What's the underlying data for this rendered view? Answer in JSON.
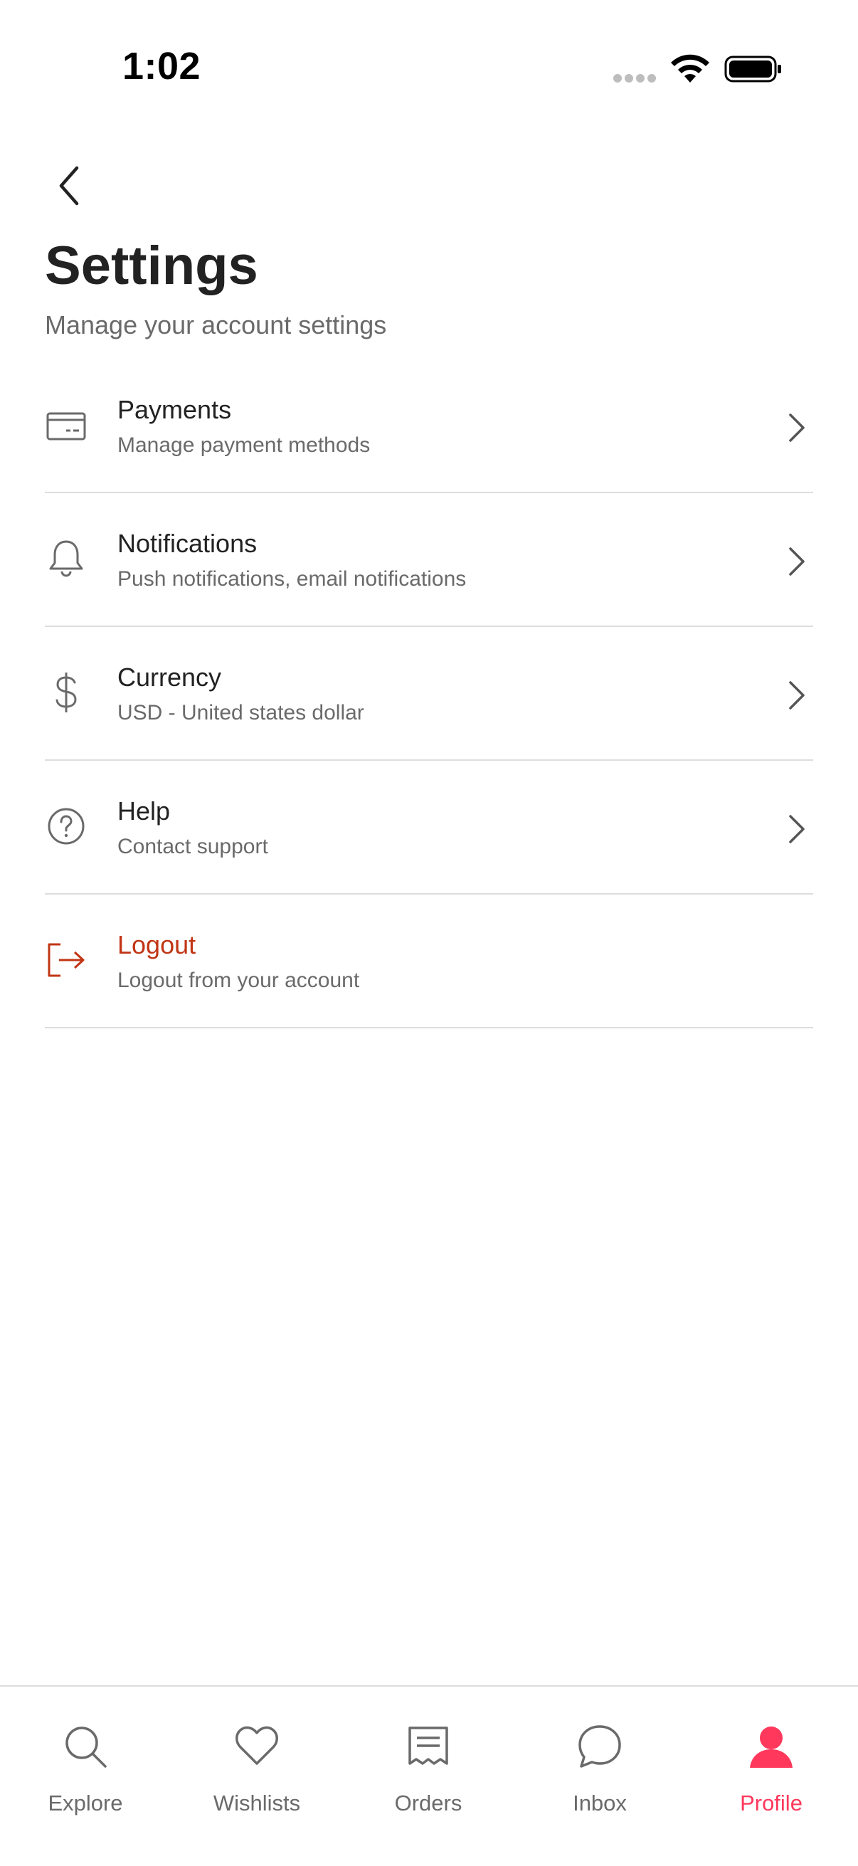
{
  "status_bar": {
    "time": "1:02"
  },
  "header": {
    "title": "Settings",
    "subtitle": "Manage your account settings"
  },
  "settings": {
    "items": [
      {
        "title": "Payments",
        "subtitle": "Manage payment methods",
        "icon": "credit-card-icon"
      },
      {
        "title": "Notifications",
        "subtitle": "Push notifications, email notifications",
        "icon": "bell-icon"
      },
      {
        "title": "Currency",
        "subtitle": "USD - United states dollar",
        "icon": "dollar-icon"
      },
      {
        "title": "Help",
        "subtitle": "Contact support",
        "icon": "help-circle-icon"
      },
      {
        "title": "Logout",
        "subtitle": "Logout from your account",
        "icon": "logout-icon"
      }
    ]
  },
  "tab_bar": {
    "tabs": [
      {
        "label": "Explore",
        "icon": "search-icon",
        "active": false
      },
      {
        "label": "Wishlists",
        "icon": "heart-icon",
        "active": false
      },
      {
        "label": "Orders",
        "icon": "receipt-icon",
        "active": false
      },
      {
        "label": "Inbox",
        "icon": "chat-bubble-icon",
        "active": false
      },
      {
        "label": "Profile",
        "icon": "profile-icon",
        "active": true
      }
    ]
  },
  "colors": {
    "accent": "#ff385c",
    "danger": "#c13515",
    "text_primary": "#222222",
    "text_secondary": "#6a6a6a",
    "divider": "#dddddd"
  }
}
